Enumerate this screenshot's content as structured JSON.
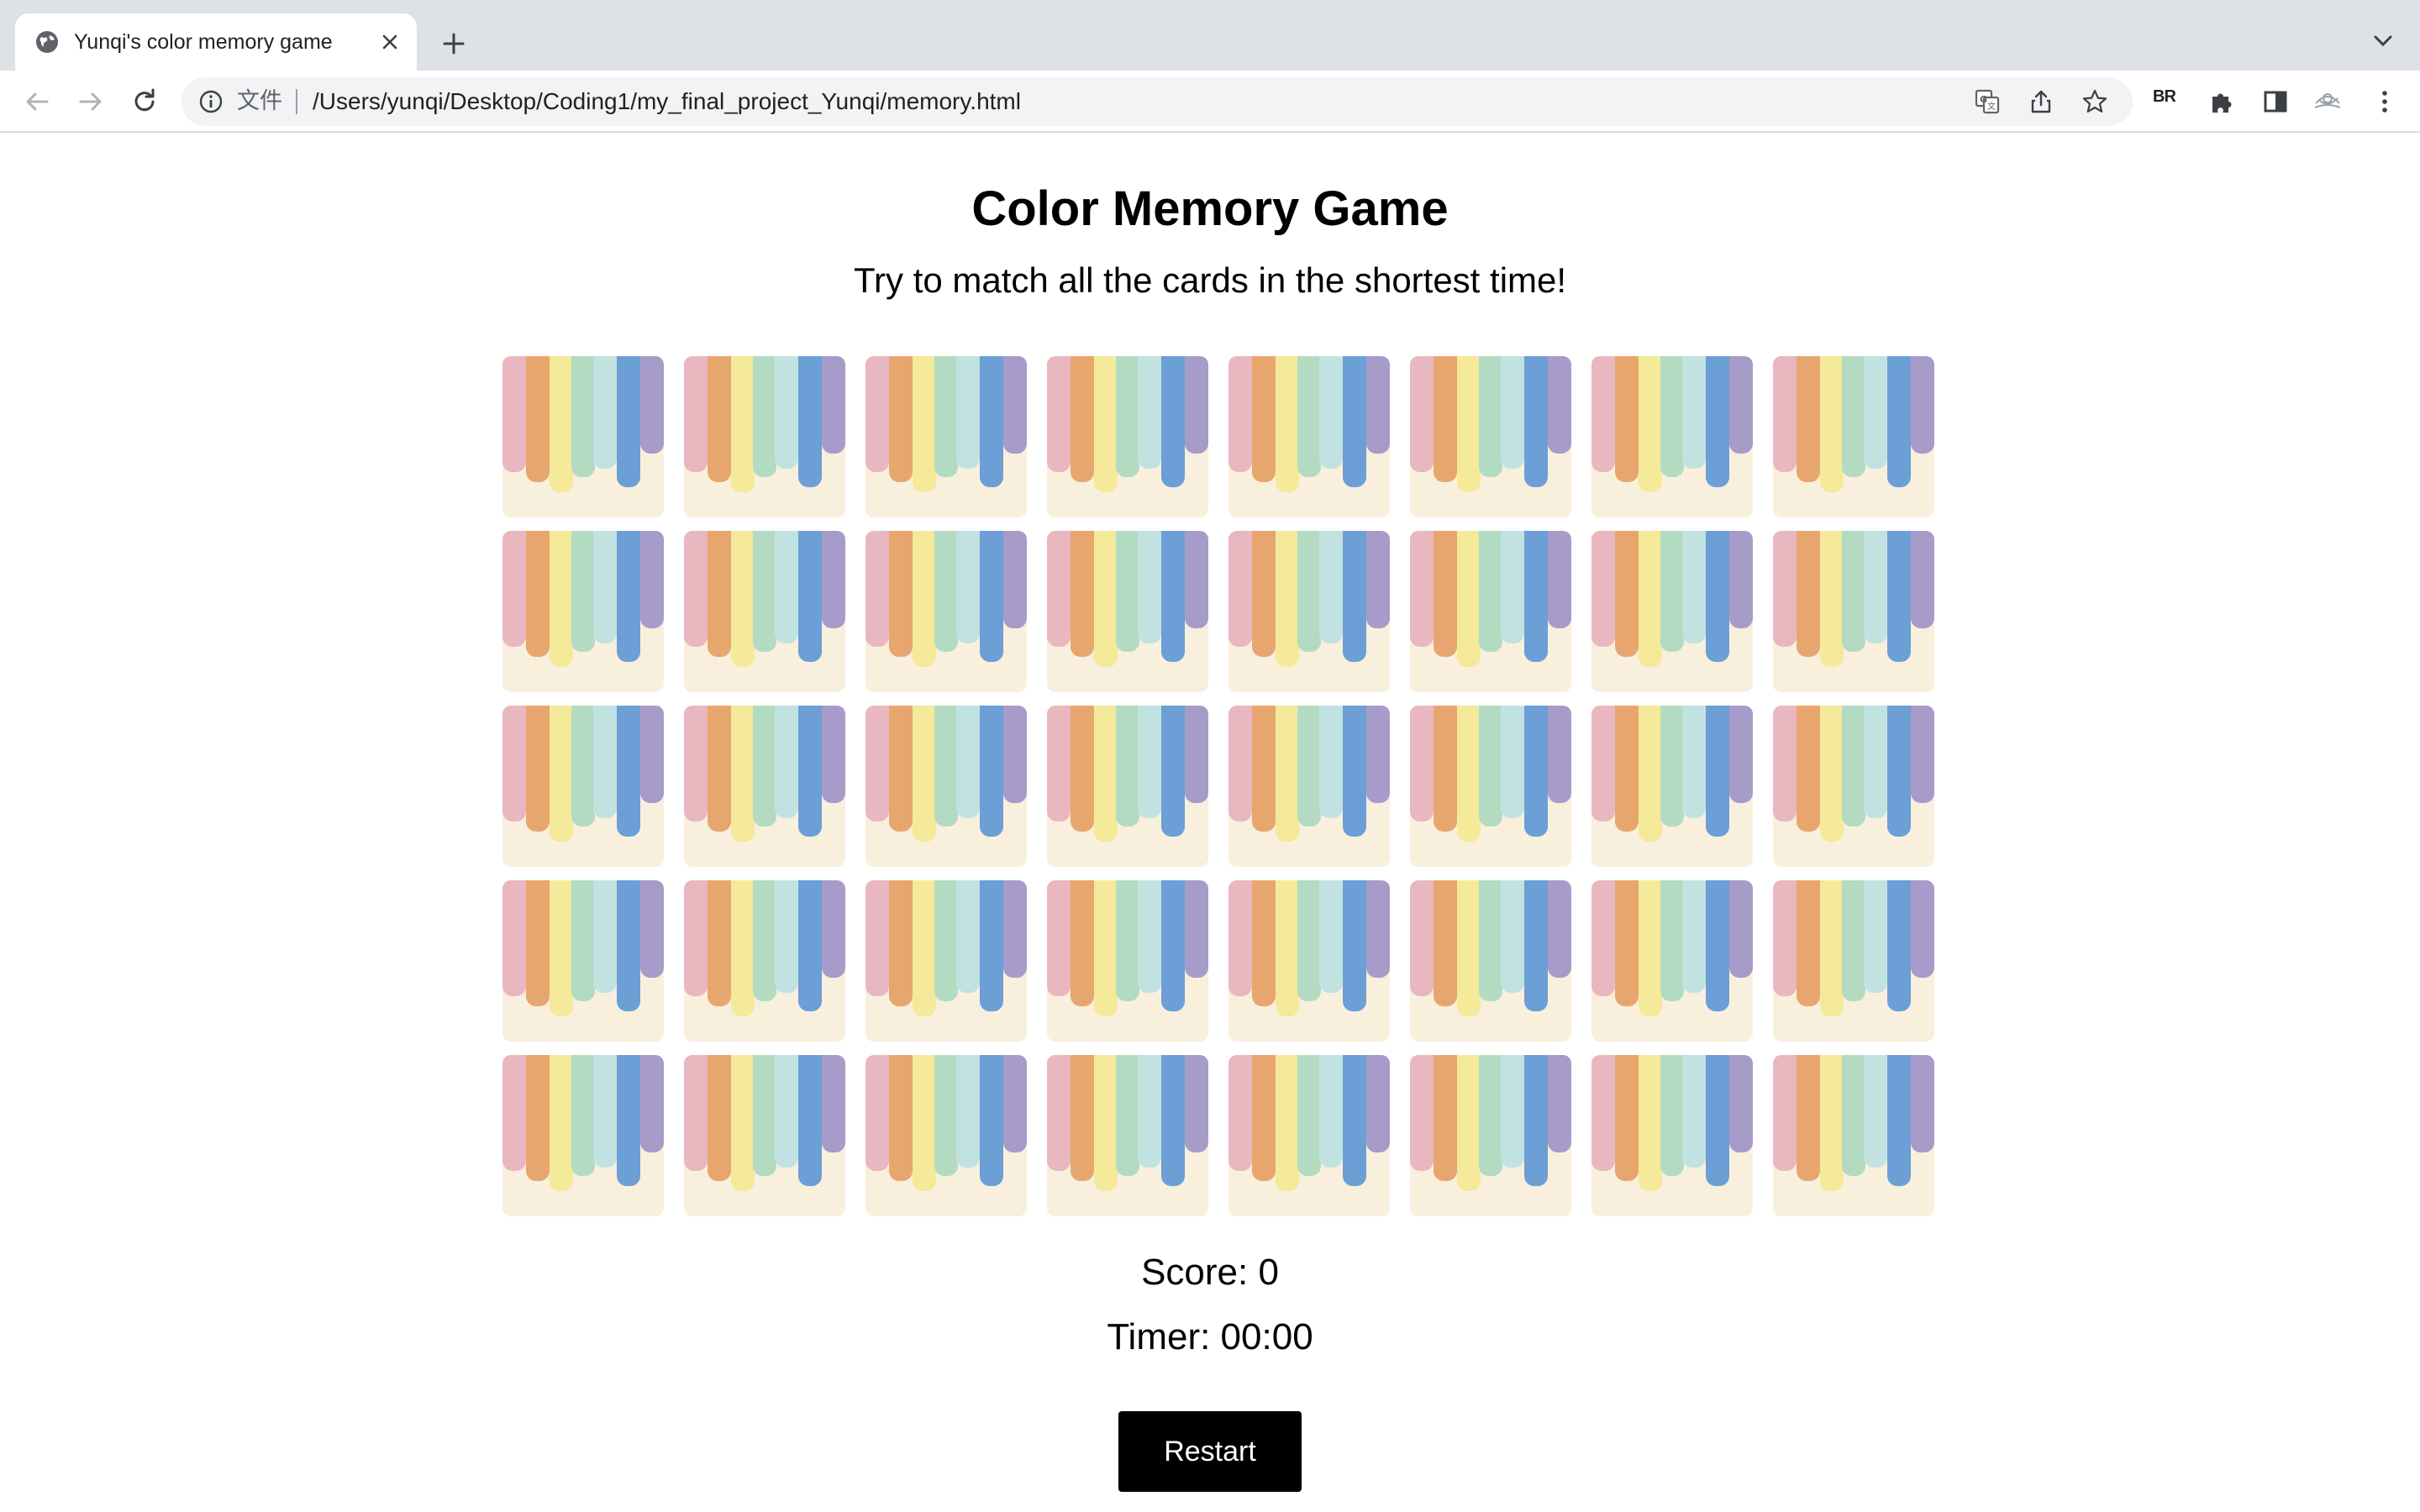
{
  "browser": {
    "tab_title": "Yunqi's color memory game",
    "omnibox_file_label": "文件",
    "url": "/Users/yunqi/Desktop/Coding1/my_final_project_Yunqi/memory.html",
    "br_extension_label": "BR"
  },
  "game": {
    "title": "Color Memory Game",
    "subtitle": "Try to match all the cards in the shortest time!",
    "grid": {
      "rows": 5,
      "columns": 8
    },
    "card_back": {
      "stripe_colors": [
        "#e9b7bf",
        "#e8a66f",
        "#f5e99a",
        "#b2dbc2",
        "#c2e2e1",
        "#6b9fd6",
        "#a79bca"
      ],
      "background": "#f9efdd"
    },
    "score_text": "Score: 0",
    "timer_text": "Timer: 00:00",
    "restart_label": "Restart"
  }
}
